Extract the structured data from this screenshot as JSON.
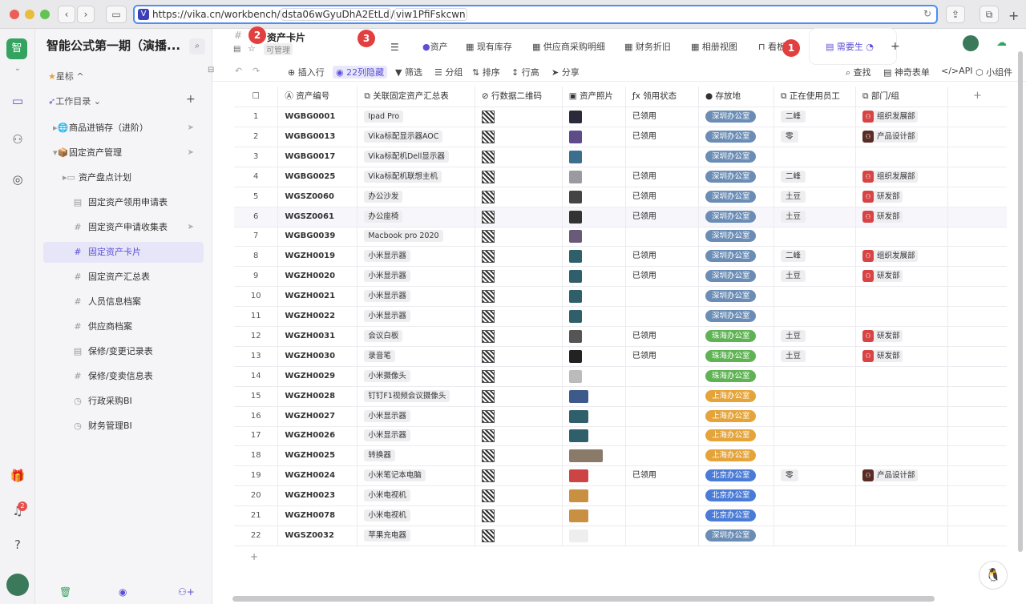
{
  "browser": {
    "url_prefix": "https://vika.cn/workbench/",
    "url_datasheet": "dsta06wGyuDhA2EtLd",
    "url_sep": "/",
    "url_view": "viw1PfiFskcwn",
    "colors": {
      "close": "#ec5f58",
      "min": "#e6be3b",
      "max": "#63c454"
    }
  },
  "rail": {
    "workspace_label": "智",
    "notification_count": "2"
  },
  "sidebar": {
    "space_title": "智能公式第一期（演播...",
    "starred_label": "星标",
    "catalog_label": "工作目录",
    "nodes": [
      {
        "label": "商品进销存（进阶）",
        "icon": "globe-icon"
      },
      {
        "label": "固定资产管理",
        "icon": "folder-icon"
      },
      {
        "label": "资产盘点计划",
        "icon": "folder-icon"
      },
      {
        "label": "固定资产领用申请表",
        "icon": "form-icon"
      },
      {
        "label": "固定资产申请收集表",
        "icon": "grid-icon"
      },
      {
        "label": "固定资产卡片",
        "icon": "grid-icon"
      },
      {
        "label": "固定资产汇总表",
        "icon": "grid-icon"
      },
      {
        "label": "人员信息档案",
        "icon": "grid-icon"
      },
      {
        "label": "供应商档案",
        "icon": "grid-icon"
      },
      {
        "label": "保修/变更记录表",
        "icon": "form-icon"
      },
      {
        "label": "保修/变卖信息表",
        "icon": "grid-icon"
      },
      {
        "label": "行政采购BI",
        "icon": "dashboard-icon"
      },
      {
        "label": "财务管理BI",
        "icon": "dashboard-icon"
      }
    ]
  },
  "header": {
    "title": "资产卡片",
    "permission": "可管理",
    "tabs": [
      "资产",
      "现有库存",
      "供应商采购明细",
      "财务折旧",
      "相册视图",
      "看板",
      "需要生"
    ]
  },
  "markers": [
    "1",
    "2",
    "3"
  ],
  "toolbar": {
    "insert": "插入行",
    "hidden": "22列隐藏",
    "filter": "筛选",
    "group": "分组",
    "sort": "排序",
    "row_height": "行高",
    "share": "分享",
    "find": "查找",
    "magic_form": "神奇表单",
    "api": "API",
    "widget": "小组件"
  },
  "table": {
    "columns": [
      "资产编号",
      "关联固定资产汇总表",
      "行数据二维码",
      "资产照片",
      "领用状态",
      "存放地",
      "正在使用员工",
      "部门/组"
    ],
    "rows": [
      {
        "n": "1",
        "id": "WGBG0001",
        "link": "Ipad Pro",
        "status": "已领用",
        "loc": "深圳办公室",
        "emp": "二峰",
        "dept": "组织发展部",
        "photo": "#2a2a3a"
      },
      {
        "n": "2",
        "id": "WGBG0013",
        "link": "Vika标配显示器AOC",
        "status": "已领用",
        "loc": "深圳办公室",
        "emp": "零",
        "dept": "产品设计部",
        "photo": "#5d4b8a"
      },
      {
        "n": "3",
        "id": "WGBG0017",
        "link": "Vika标配机Dell显示器",
        "status": "",
        "loc": "深圳办公室",
        "emp": "",
        "dept": "",
        "photo": "#3b6f8d"
      },
      {
        "n": "4",
        "id": "WGBG0025",
        "link": "Vika标配机联想主机",
        "status": "已领用",
        "loc": "深圳办公室",
        "emp": "二峰",
        "dept": "组织发展部",
        "photo": "#9a9aa0"
      },
      {
        "n": "5",
        "id": "WGSZ0060",
        "link": "办公沙发",
        "status": "已领用",
        "loc": "深圳办公室",
        "emp": "土豆",
        "dept": "研发部",
        "photo": "#444"
      },
      {
        "n": "6",
        "id": "WGSZ0061",
        "link": "办公座椅",
        "status": "已领用",
        "loc": "深圳办公室",
        "emp": "土豆",
        "dept": "研发部",
        "photo": "#333"
      },
      {
        "n": "7",
        "id": "WGBG0039",
        "link": "Macbook pro 2020",
        "status": "",
        "loc": "深圳办公室",
        "emp": "",
        "dept": "",
        "photo": "#6a5a7a"
      },
      {
        "n": "8",
        "id": "WGZH0019",
        "link": "小米显示器",
        "status": "已领用",
        "loc": "深圳办公室",
        "emp": "二峰",
        "dept": "组织发展部",
        "photo": "#2f5f6a"
      },
      {
        "n": "9",
        "id": "WGZH0020",
        "link": "小米显示器",
        "status": "已领用",
        "loc": "深圳办公室",
        "emp": "土豆",
        "dept": "研发部",
        "photo": "#2f5f6a"
      },
      {
        "n": "10",
        "id": "WGZH0021",
        "link": "小米显示器",
        "status": "",
        "loc": "深圳办公室",
        "emp": "",
        "dept": "",
        "photo": "#2f5f6a"
      },
      {
        "n": "11",
        "id": "WGZH0022",
        "link": "小米显示器",
        "status": "",
        "loc": "深圳办公室",
        "emp": "",
        "dept": "",
        "photo": "#2f5f6a"
      },
      {
        "n": "12",
        "id": "WGZH0031",
        "link": "会议白板",
        "status": "已领用",
        "loc": "珠海办公室",
        "emp": "土豆",
        "dept": "研发部",
        "photo": "#555"
      },
      {
        "n": "13",
        "id": "WGZH0030",
        "link": "录音笔",
        "status": "已领用",
        "loc": "珠海办公室",
        "emp": "土豆",
        "dept": "研发部",
        "photo": "#222"
      },
      {
        "n": "14",
        "id": "WGZH0029",
        "link": "小米摄像头",
        "status": "",
        "loc": "珠海办公室",
        "emp": "",
        "dept": "",
        "photo": "#bbb"
      },
      {
        "n": "15",
        "id": "WGZH0028",
        "link": "钉钉F1视频会议摄像头",
        "status": "",
        "loc": "上海办公室",
        "emp": "",
        "dept": "",
        "photo": "#3d5a8a"
      },
      {
        "n": "16",
        "id": "WGZH0027",
        "link": "小米显示器",
        "status": "",
        "loc": "上海办公室",
        "emp": "",
        "dept": "",
        "photo": "#2f5f6a"
      },
      {
        "n": "17",
        "id": "WGZH0026",
        "link": "小米显示器",
        "status": "",
        "loc": "上海办公室",
        "emp": "",
        "dept": "",
        "photo": "#2f5f6a"
      },
      {
        "n": "18",
        "id": "WGZH0025",
        "link": "转换器",
        "status": "",
        "loc": "上海办公室",
        "emp": "",
        "dept": "",
        "photo": "#8a7a6a"
      },
      {
        "n": "19",
        "id": "WGZH0024",
        "link": "小米笔记本电脑",
        "status": "已领用",
        "loc": "北京办公室",
        "emp": "零",
        "dept": "产品设计部",
        "photo": "#c44"
      },
      {
        "n": "20",
        "id": "WGZH0023",
        "link": "小米电视机",
        "status": "",
        "loc": "北京办公室",
        "emp": "",
        "dept": "",
        "photo": "#c89040"
      },
      {
        "n": "21",
        "id": "WGZH0078",
        "link": "小米电视机",
        "status": "",
        "loc": "北京办公室",
        "emp": "",
        "dept": "",
        "photo": "#c89040"
      },
      {
        "n": "22",
        "id": "WGSZ0032",
        "link": "苹果充电器",
        "status": "",
        "loc": "深圳办公室",
        "emp": "",
        "dept": "",
        "photo": "#eee"
      }
    ],
    "add_row": "+",
    "add_col": "+"
  },
  "colors": {
    "accent": "#5b4fd6",
    "loc_shenzhen": "#6b8db5",
    "loc_zhuhai": "#5fb354",
    "loc_shanghai": "#e4a43a",
    "loc_beijing": "#4a7bd6",
    "dept_org": "#d84343",
    "dept_design": "#5a2a24",
    "dept_rd": "#d84343"
  }
}
